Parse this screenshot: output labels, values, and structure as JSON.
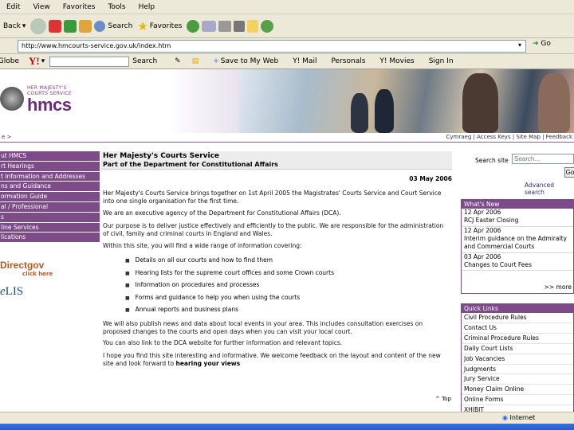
{
  "browser": {
    "menu": [
      "Edit",
      "View",
      "Favorites",
      "Tools",
      "Help"
    ],
    "toolbar": {
      "back": "Back",
      "search": "Search",
      "favorites": "Favorites"
    },
    "address": "http://www.hmcourts-service.gov.uk/index.htm",
    "go": "Go",
    "yahoo": {
      "globe": "Globe",
      "search": "Search",
      "save": "Save to My Web",
      "mail": "Y! Mail",
      "personals": "Personals",
      "movies": "Y! Movies",
      "signin": "Sign In"
    },
    "status": "Internet"
  },
  "header": {
    "logo_small_1": "HER MAJESTY'S",
    "logo_small_2": "COURTS SERVICE",
    "logo_big": "hmcs"
  },
  "nav_strip": {
    "crumb": "e >",
    "toplinks": "Cymraeg | Access Keys | Site Map | Feedback"
  },
  "leftnav": {
    "items": [
      "ut HMCS",
      "rt Hearings",
      "t Information and Addresses",
      "ns and Guidance",
      "ormation Guide",
      "al / Professional",
      "s",
      "line Services",
      "lications"
    ],
    "directgov": "Directgov",
    "directgov_sub": "click here",
    "elis": "LIS",
    "elis_prefix": "e"
  },
  "main": {
    "title": "Her Majesty's Courts Service",
    "subtitle": "Part of the Department for Constitutional Affairs",
    "date": "03 May 2006",
    "p1": "Her Majesty's Courts Service brings together on 1st April 2005 the Magistrates' Courts Service and Court Service into one single organisation for the first time.",
    "p2": "We are an executive agency of the Department for Constitutional Affairs (DCA).",
    "p3": "Our purpose is to deliver justice effectively and efficiently to the public. We are responsible for the administration of civil, family and criminal courts in England and Wales.",
    "p4": "Within this site, you will find a wide range of information covering:",
    "bullets": [
      "Details on all our courts and how to find them",
      "Hearing lists for the supreme court offices and some Crown courts",
      "Information on procedures and processes",
      "Forms and guidance to help you when using the courts",
      "Annual reports and business plans"
    ],
    "p5": "We will also publish news and data about local events in your area. This includes consultation exercises on proposed changes to the courts and open days when you can visit your local court.",
    "p6": "You can also link to the DCA website for further information and relevant topics.",
    "p7": "I hope you find this site interesting and informative. We welcome feedback on the layout and content of the new site and look forward to",
    "p7_link": "hearing your views",
    "top": "^ Top"
  },
  "search": {
    "label": "Search site",
    "placeholder": "Search...",
    "go": "Go",
    "advanced": "Advanced search"
  },
  "news": {
    "heading": "What's New",
    "items": [
      {
        "date": "12 Apr 2006",
        "title": "RCJ Easter Closing"
      },
      {
        "date": "12 Apr 2006",
        "title": "Interim guidance on the Admiralty and Commercial Courts"
      },
      {
        "date": "03 Apr 2006",
        "title": "Changes to Court Fees"
      }
    ],
    "more": ">> more"
  },
  "quicklinks": {
    "heading": "Quick Links",
    "items": [
      "Civil Procedure Rules",
      "Contact Us",
      "Criminal Procedure Rules",
      "Daily Court Lists",
      "Job Vacancies",
      "Judgments",
      "Jury Service",
      "Money Claim Online",
      "Online Forms",
      "XHIBIT"
    ]
  },
  "colors": {
    "brand_purple": "#7d4b88",
    "chrome": "#ece9d8",
    "directgov_orange": "#c8541a"
  }
}
